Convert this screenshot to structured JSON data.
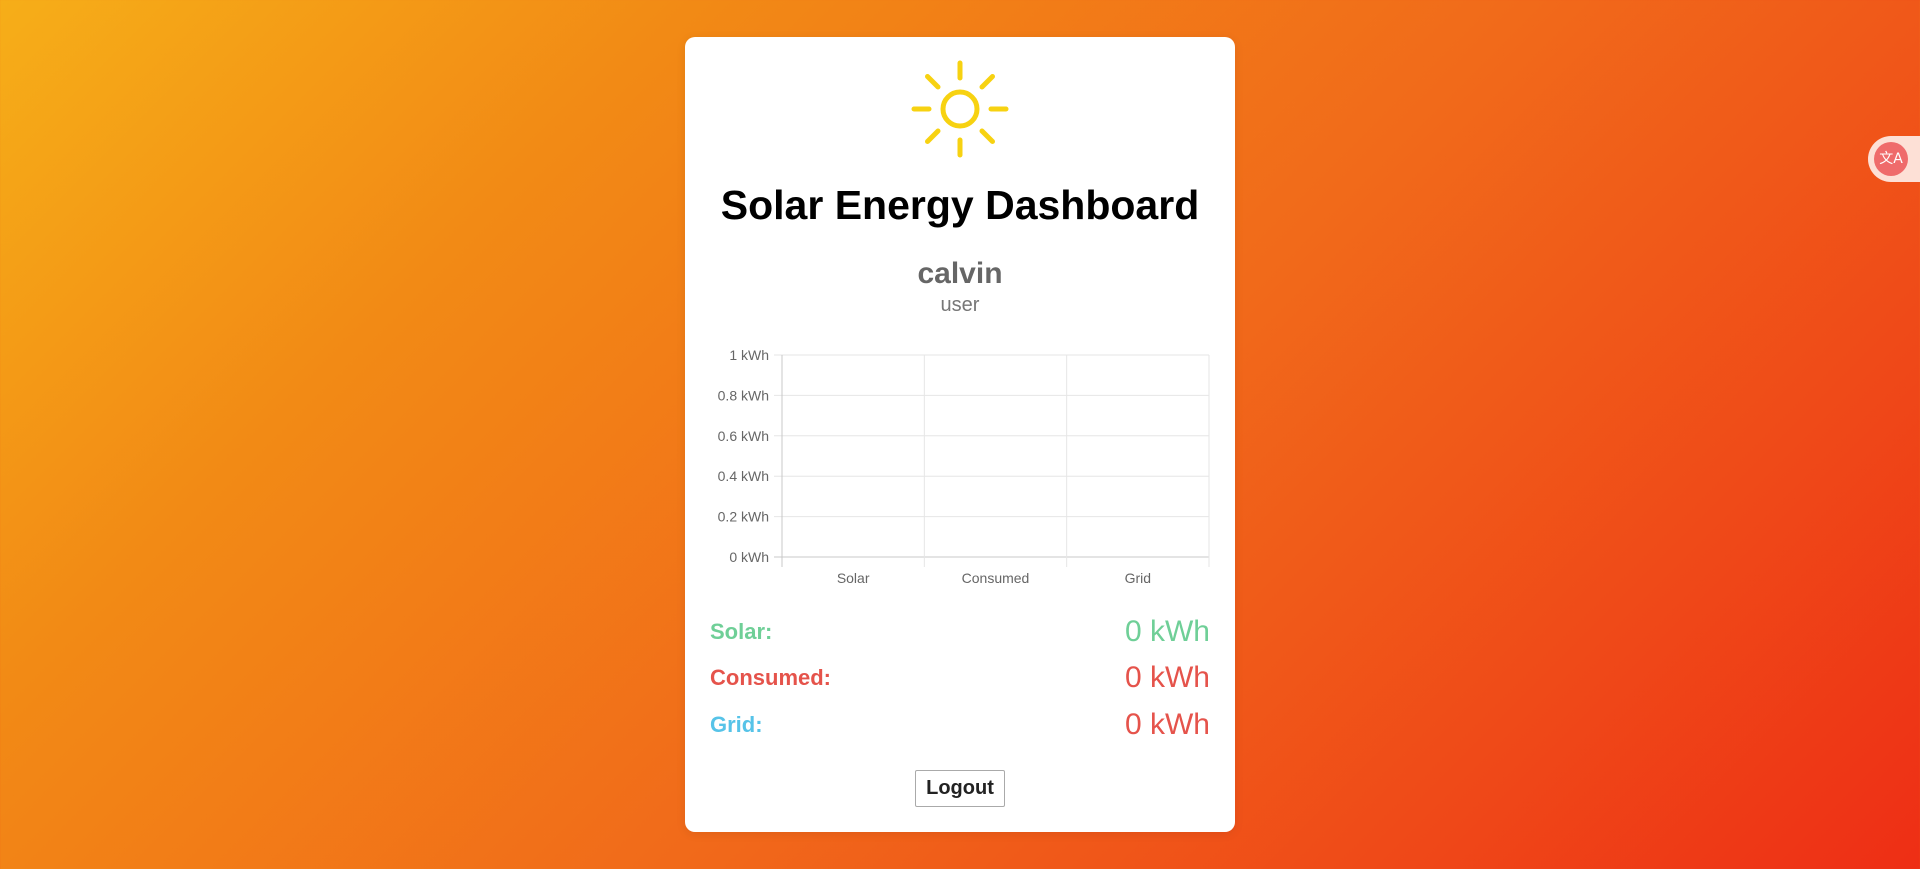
{
  "header": {
    "icon": "sun-icon",
    "title": "Solar Energy Dashboard"
  },
  "user": {
    "name": "calvin",
    "role": "user"
  },
  "chart_data": {
    "type": "bar",
    "categories": [
      "Solar",
      "Consumed",
      "Grid"
    ],
    "values": [
      0,
      0,
      0
    ],
    "y_ticks": [
      "0 kWh",
      "0.2 kWh",
      "0.4 kWh",
      "0.6 kWh",
      "0.8 kWh",
      "1 kWh"
    ],
    "ylim": [
      0,
      1
    ],
    "unit": "kWh",
    "grid": true
  },
  "stats": [
    {
      "label": "Solar:",
      "value": "0 kWh",
      "label_color": "#6fcf97",
      "value_color": "#6fcf97"
    },
    {
      "label": "Consumed:",
      "value": "0 kWh",
      "label_color": "#e5534b",
      "value_color": "#e5534b"
    },
    {
      "label": "Grid:",
      "value": "0 kWh",
      "label_color": "#56c3e8",
      "value_color": "#e5534b"
    }
  ],
  "actions": {
    "logout_label": "Logout"
  },
  "extension": {
    "icon": "translate-icon",
    "glyph": "文A"
  },
  "colors": {
    "sun": "#f7d211",
    "card_background": "#ffffff"
  }
}
